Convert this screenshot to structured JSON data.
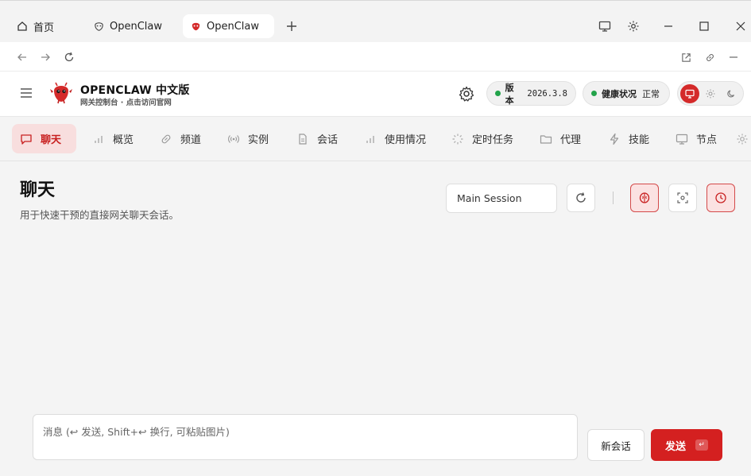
{
  "browser": {
    "tabs": [
      {
        "label": "首页",
        "icon": "home-icon"
      },
      {
        "label": "OpenClaw",
        "icon": "claw-logo-icon"
      },
      {
        "label": "OpenClaw",
        "icon": "claw-logo-icon"
      }
    ]
  },
  "header": {
    "brand_title": "OPENCLAW 中文版",
    "brand_subtitle": "网关控制台 · 点击访问官网",
    "version_label": "版本",
    "version_value": "2026.3.8",
    "health_label": "健康状况",
    "health_value": "正常"
  },
  "nav": {
    "items": [
      {
        "label": "聊天",
        "icon": "chat-icon"
      },
      {
        "label": "概览",
        "icon": "bar-chart-icon"
      },
      {
        "label": "频道",
        "icon": "link-icon"
      },
      {
        "label": "实例",
        "icon": "broadcast-icon"
      },
      {
        "label": "会话",
        "icon": "document-icon"
      },
      {
        "label": "使用情况",
        "icon": "bar-chart-icon"
      },
      {
        "label": "定时任务",
        "icon": "loader-icon"
      },
      {
        "label": "代理",
        "icon": "folder-icon"
      },
      {
        "label": "技能",
        "icon": "lightning-icon"
      },
      {
        "label": "节点",
        "icon": "monitor-icon"
      }
    ]
  },
  "page": {
    "title": "聊天",
    "subtitle": "用于快速干预的直接网关聊天会话。",
    "session_value": "Main Session"
  },
  "composer": {
    "placeholder": "消息 (↩ 发送, Shift+↩ 换行, 可粘贴图片)",
    "new_session_label": "新会话",
    "send_label": "发送",
    "send_shortcut": "↵"
  },
  "colors": {
    "accent": "#d42020",
    "accent_soft": "#f8dede",
    "status_ok": "#22a34a"
  }
}
